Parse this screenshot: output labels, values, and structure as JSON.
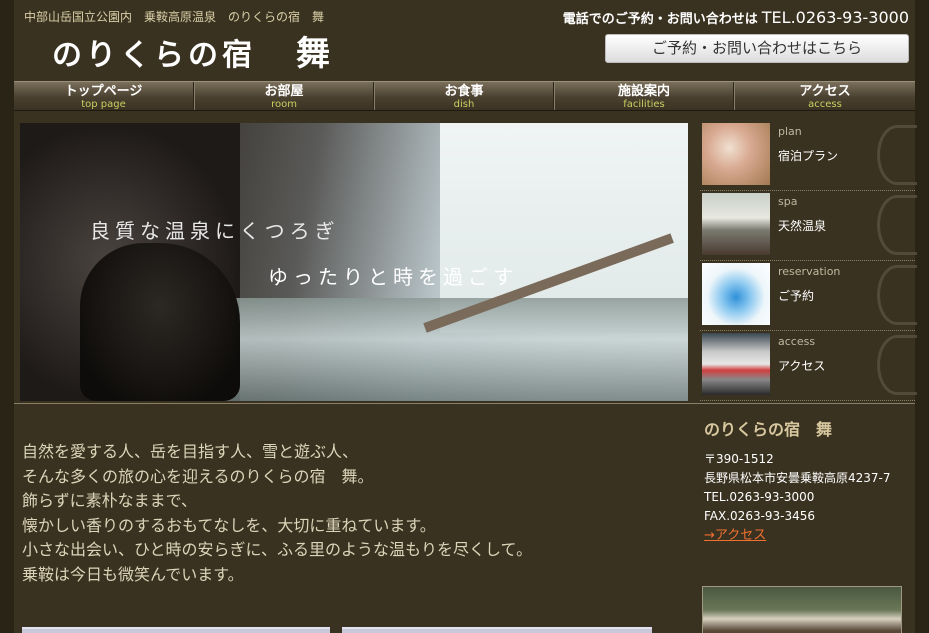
{
  "header": {
    "tagline": "中部山岳国立公園内　乗鞍高原温泉　のりくらの宿　舞",
    "logo_main": "のりくらの宿",
    "logo_sub": "舞",
    "tel_label": "電話でのご予約・お問い合わせは",
    "tel_number": "TEL.0263-93-3000",
    "contact_button": "ご予約・お問い合わせはこちら"
  },
  "nav": [
    {
      "jp": "トップページ",
      "en": "top page"
    },
    {
      "jp": "お部屋",
      "en": "room"
    },
    {
      "jp": "お食事",
      "en": "dish"
    },
    {
      "jp": "施設案内",
      "en": "facilities"
    },
    {
      "jp": "アクセス",
      "en": "access"
    }
  ],
  "hero": {
    "line1": "良質な温泉にくつろぎ",
    "line2": "ゆったりと時を過ごす"
  },
  "side_menu": [
    {
      "en": "plan",
      "jp": "宿泊プラン"
    },
    {
      "en": "spa",
      "jp": "天然温泉"
    },
    {
      "en": "reservation",
      "jp": "ご予約"
    },
    {
      "en": "access",
      "jp": "アクセス"
    }
  ],
  "intro": [
    "自然を愛する人、岳を目指す人、雪と遊ぶ人、",
    "そんな多くの旅の心を迎えるのりくらの宿　舞。",
    "飾らずに素朴なままで、",
    "懐かしい香りのするおもてなしを、大切に重ねています。",
    "小さな出会い、ひと時の安らぎに、ふる里のような温もりを尽くして。",
    "乗鞍は今日も微笑んでいます。"
  ],
  "info": {
    "name": "のりくらの宿　舞",
    "postal": "〒390-1512",
    "address": "長野県松本市安曇乗鞍高原4237-7",
    "tel": "TEL.0263-93-3000",
    "fax": "FAX.0263-93-3456",
    "access_link": "→アクセス"
  }
}
